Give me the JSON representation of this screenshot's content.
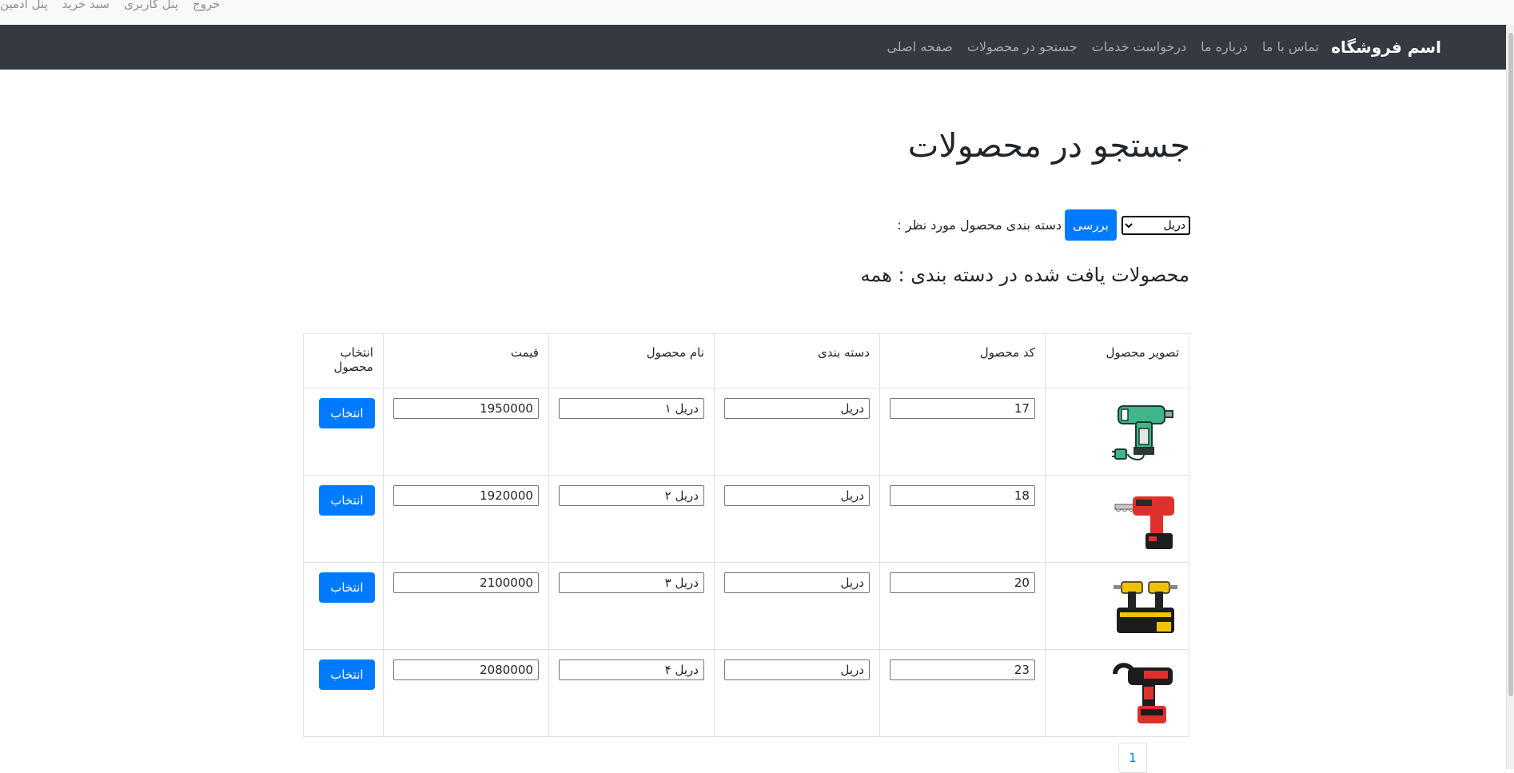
{
  "top_links": [
    "پنل ادمین",
    "سبد خرید",
    "پنل کاربری",
    "خروج"
  ],
  "navbar": {
    "brand": "اسم فروشگاه",
    "links": [
      "صفحه اصلی",
      "جستجو در محصولات",
      "درخواست خدمات",
      "درباره ما",
      "تماس با ما"
    ]
  },
  "page_title": "جستجو در محصولات",
  "filter": {
    "label": "دسته بندی محصول مورد نظر :",
    "button": "بررسی",
    "selected": "دریل"
  },
  "result_heading": "محصولات یافت شده در دسته بندی : همه",
  "table": {
    "headers": [
      "تصویر محصول",
      "کد محصول",
      "دسته بندی",
      "نام محصول",
      "قیمت",
      "انتخاب محصول"
    ],
    "select_label": "انتخاب",
    "rows": [
      {
        "image": "green-drill-icon",
        "code": "17",
        "category": "دریل",
        "name": "دریل ۱",
        "price": "1950000"
      },
      {
        "image": "red-saw-drill-icon",
        "code": "18",
        "category": "دریل",
        "name": "دریل ۲",
        "price": "1920000"
      },
      {
        "image": "yellow-drill-kit-icon",
        "code": "20",
        "category": "دریل",
        "name": "دریل ۳",
        "price": "2100000"
      },
      {
        "image": "red-rebar-tool-icon",
        "code": "23",
        "category": "دریل",
        "name": "دریل ۴",
        "price": "2080000"
      }
    ]
  },
  "pagination": {
    "current": "1"
  }
}
